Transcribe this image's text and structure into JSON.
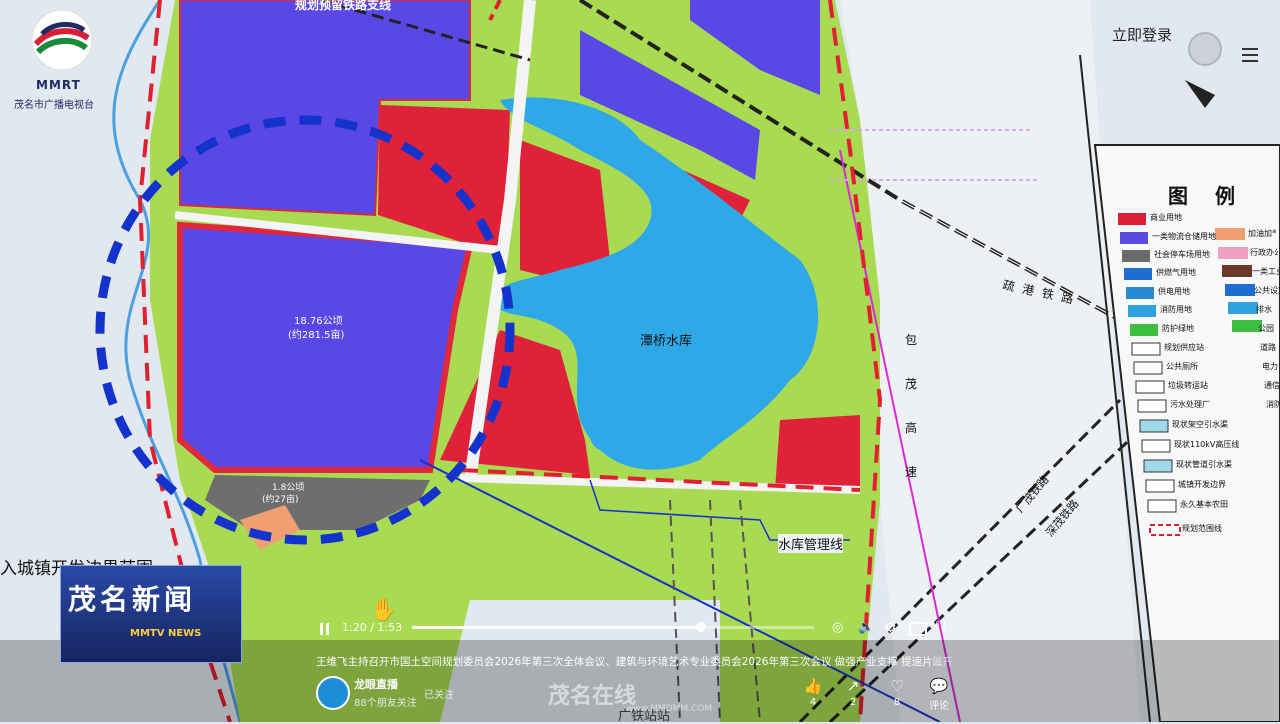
{
  "topbar": {
    "login_label": "立即登录"
  },
  "station": {
    "logo_text": "MMRT",
    "name": "茂名市广播电视台"
  },
  "news_badge": {
    "title": "茂名新闻",
    "subtitle": "MMTV NEWS"
  },
  "map": {
    "labels": {
      "railway_top": "规划预留铁路支线",
      "area_main": "18.76公顷",
      "area_main_mu": "(约281.5亩)",
      "area_small": "1.8公顷",
      "area_small_mu": "(约27亩)",
      "reservoir": "潭桥水库",
      "reservoir_line": "水库管理线",
      "port_railway": "疏港铁路",
      "expressway": "包茂高速",
      "guangmao_rail": "广茂铁路",
      "shenmao_rail": "深茂铁路",
      "town_boundary": "入城镇开发边界范围",
      "station": "广铁站站"
    },
    "legend": {
      "title": "图 例",
      "items": [
        {
          "label": "商业用地",
          "color": "#d81f33"
        },
        {
          "label": "一类物流仓储用地",
          "color": "#5b4ae0"
        },
        {
          "label": "社会停车场用地",
          "color": "#6b6b6b"
        },
        {
          "label": "供燃气用地",
          "color": "#1f6ed1"
        },
        {
          "label": "供电用地",
          "color": "#2a8ad1"
        },
        {
          "label": "消防用地",
          "color": "#2fa0e0"
        },
        {
          "label": "防护绿地",
          "color": "#3fbf3f"
        },
        {
          "label": "规划供应站",
          "color": "#ffffff"
        },
        {
          "label": "公共厕所",
          "color": "#ffffff"
        },
        {
          "label": "垃圾转运站",
          "color": "#ffffff"
        },
        {
          "label": "污水处理厂",
          "color": "#ffffff"
        },
        {
          "label": "现状架空引水渠",
          "color": "#9fd8e8"
        },
        {
          "label": "现状110kV高压线",
          "color": "#ffffff"
        },
        {
          "label": "现状管道引水渠",
          "color": "#9fd8e8"
        },
        {
          "label": "城镇开发边界",
          "color": "#ffffff"
        },
        {
          "label": "永久基本农田",
          "color": "#ffffff"
        },
        {
          "label": "规划范围线",
          "color": "#d81f33"
        }
      ],
      "right_items": [
        "加油加气站",
        "行政办公",
        "一类工业",
        "公共设施",
        "排水",
        "公园",
        "道路",
        "电力",
        "通信",
        "消防"
      ]
    }
  },
  "player": {
    "time": "1:20 / 1:53",
    "progress_fraction": 0.72,
    "caption": "王维飞主持召开市国土空间规划委员会2026年第三次全体会议、建筑与环境艺术专业委员会2026年第三次会议 做强产业支撑 提速片...",
    "expand_label": "展开"
  },
  "channel": {
    "name": "龙眼直播",
    "followers": "88个朋友关注",
    "follow_state": "已关注"
  },
  "watermark": {
    "text": "茂名在线",
    "url": "www.MMDMM.COM"
  },
  "actions": {
    "like": "4",
    "share": "2",
    "favorite": "8",
    "comment": "评论"
  }
}
